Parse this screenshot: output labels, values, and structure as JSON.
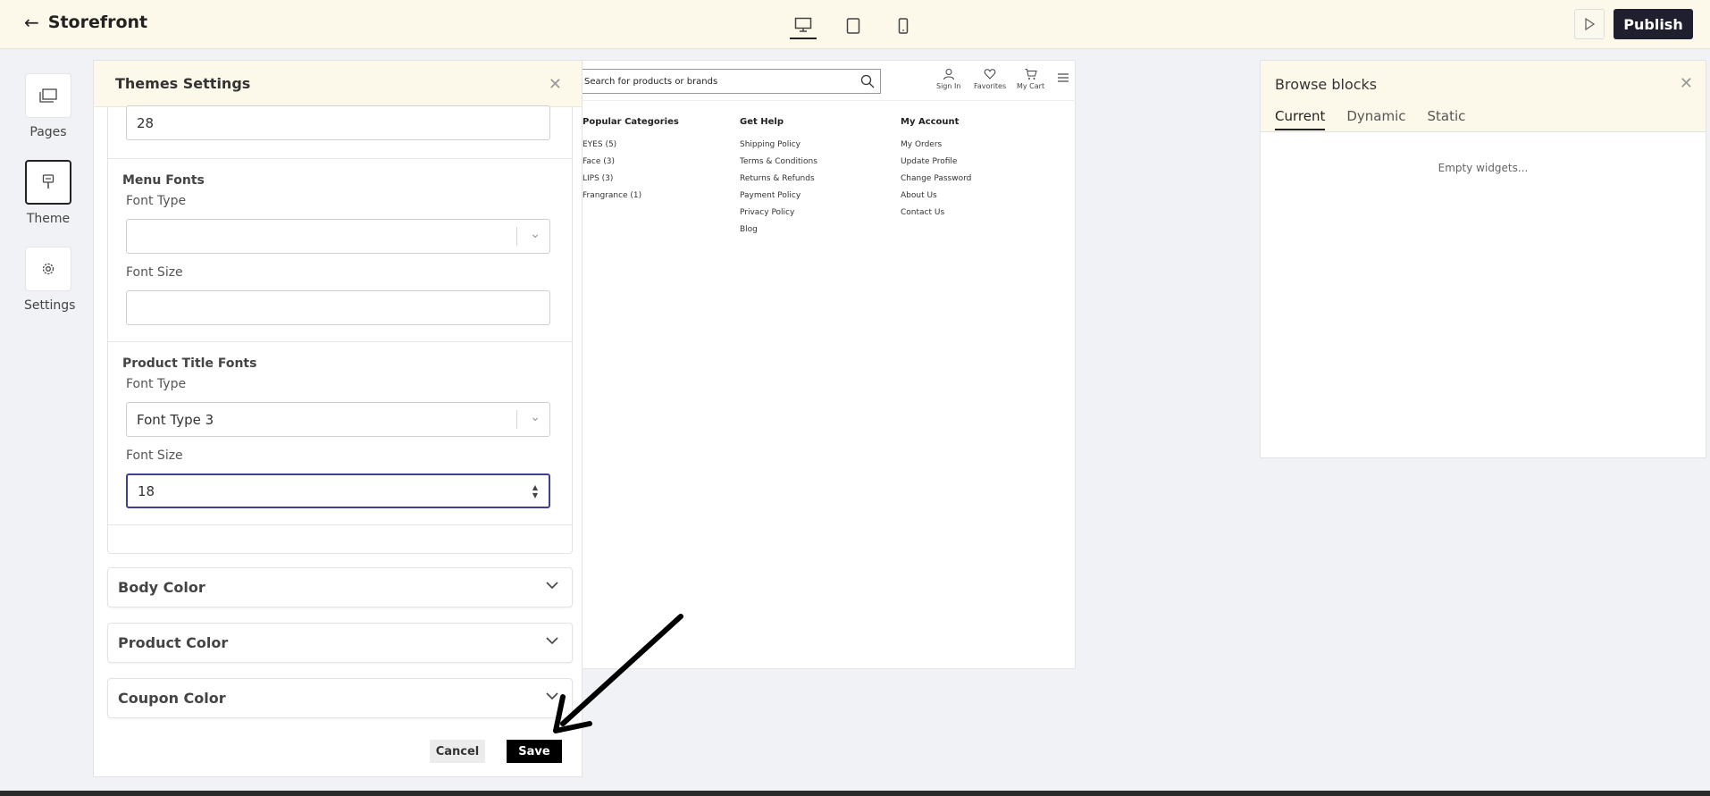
{
  "header": {
    "back_label": "Storefront",
    "publish_label": "Publish"
  },
  "rail": {
    "pages_label": "Pages",
    "theme_label": "Theme",
    "settings_label": "Settings"
  },
  "theme_panel": {
    "title": "Themes Settings",
    "top_field_value": "28",
    "menu_fonts": {
      "title": "Menu Fonts",
      "font_type_label": "Font Type",
      "font_type_value": "",
      "font_size_label": "Font Size",
      "font_size_value": ""
    },
    "product_title_fonts": {
      "title": "Product Title Fonts",
      "font_type_label": "Font Type",
      "font_type_value": "Font Type 3",
      "font_size_label": "Font Size",
      "font_size_value": "18"
    },
    "accordions": [
      "Body Color",
      "Product Color",
      "Coupon Color"
    ],
    "cancel_label": "Cancel",
    "save_label": "Save"
  },
  "preview": {
    "search_placeholder": "Search for products or brands",
    "icons": {
      "sign_in": "Sign In",
      "favorites": "Favorites",
      "cart": "My Cart"
    },
    "columns": [
      {
        "title": "Popular Categories",
        "items": [
          "EYES (5)",
          "Face (3)",
          "LIPS (3)",
          "Frangrance (1)"
        ]
      },
      {
        "title": "Get Help",
        "items": [
          "Shipping Policy",
          "Terms & Conditions",
          "Returns & Refunds",
          "Payment Policy",
          "Privacy Policy",
          "Blog"
        ]
      },
      {
        "title": "My Account",
        "items": [
          "My Orders",
          "Update Profile",
          "Change Password",
          "About Us",
          "Contact Us"
        ]
      }
    ]
  },
  "browse": {
    "title": "Browse blocks",
    "tabs": [
      "Current",
      "Dynamic",
      "Static"
    ],
    "empty_text": "Empty widgets..."
  },
  "colors": {
    "header_bg": "#fdf9ea",
    "publish_bg": "#1f1f30",
    "save_bg": "#000000",
    "focus_border": "#3f3f96"
  }
}
